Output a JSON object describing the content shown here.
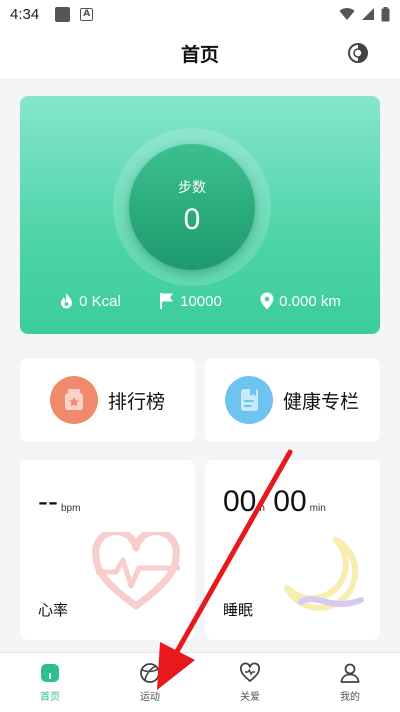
{
  "status_bar": {
    "time": "4:34",
    "icons": [
      "notification-square-icon",
      "a-icon",
      "wifi-icon",
      "signal-icon",
      "battery-icon"
    ]
  },
  "header": {
    "title": "首页",
    "action_icon": "theme-toggle-icon"
  },
  "steps": {
    "label": "步数",
    "value": "0"
  },
  "stats": {
    "calories": "0 Kcal",
    "goal": "10000",
    "distance": "0.000 km"
  },
  "tiles": {
    "ranking": "排行榜",
    "health": "健康专栏"
  },
  "heart_rate": {
    "value": "--",
    "unit": "bpm",
    "label": "心率"
  },
  "sleep": {
    "hours": "00",
    "h_unit": "h",
    "minutes": "00",
    "m_unit": "min",
    "label": "睡眠"
  },
  "nav": [
    {
      "label": "首页",
      "icon": "home-icon",
      "active": true
    },
    {
      "label": "运动",
      "icon": "sport-ball-icon",
      "active": false
    },
    {
      "label": "关爱",
      "icon": "heart-icon",
      "active": false
    },
    {
      "label": "我的",
      "icon": "user-icon",
      "active": false
    }
  ],
  "colors": {
    "accent": "#2fbf8d",
    "hero_top": "#86e6cd",
    "hero_bottom": "#3ccc9c",
    "annotation": "#e8191c"
  }
}
